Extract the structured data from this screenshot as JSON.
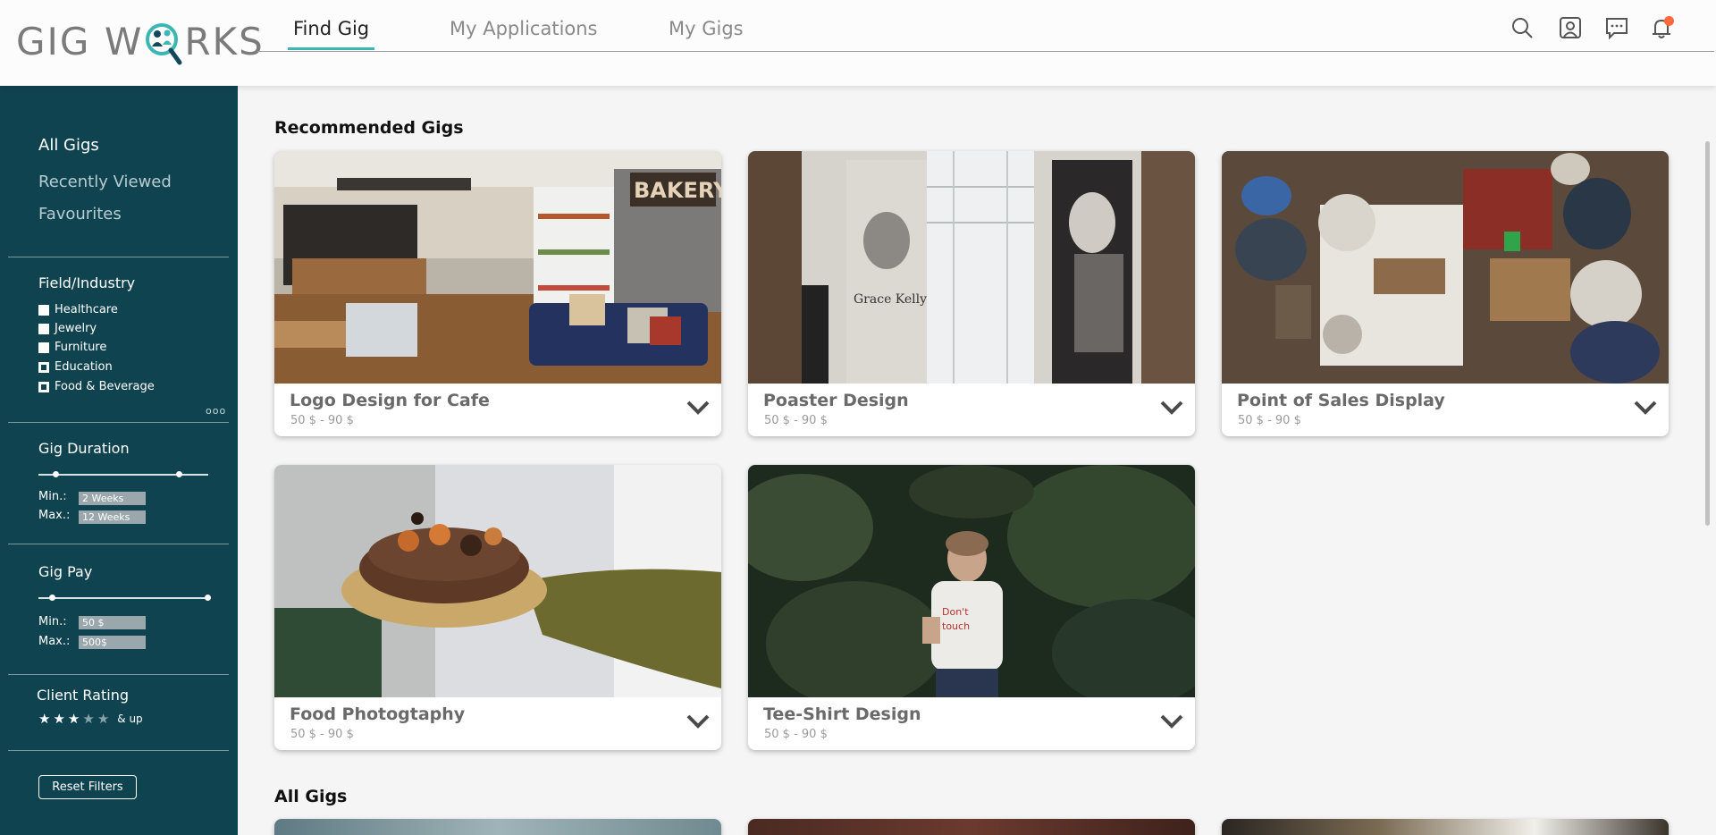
{
  "app": {
    "logo_left": "GIG W",
    "logo_right": "RKS"
  },
  "header": {
    "tabs": [
      {
        "label": "Find Gig",
        "active": true
      },
      {
        "label": "My Applications",
        "active": false
      },
      {
        "label": "My Gigs",
        "active": false
      }
    ],
    "icons": [
      "search-icon",
      "profile-icon",
      "messages-icon",
      "notifications-icon"
    ],
    "accent_color": "#3cb6b2",
    "notification_dot_color": "#ff6a3d"
  },
  "sidebar": {
    "links": [
      {
        "label": "All Gigs",
        "active": true
      },
      {
        "label": "Recently Viewed",
        "active": false
      },
      {
        "label": "Favourites",
        "active": false
      }
    ],
    "field_industry": {
      "title": "Field/Industry",
      "options": [
        {
          "label": "Healthcare",
          "checked": false
        },
        {
          "label": "Jewelry",
          "checked": false
        },
        {
          "label": "Furniture",
          "checked": false
        },
        {
          "label": "Education",
          "checked": true
        },
        {
          "label": "Food & Beverage",
          "checked": true
        }
      ],
      "more": "ooo"
    },
    "gig_duration": {
      "title": "Gig Duration",
      "min_label": "Min.:",
      "max_label": "Max.:",
      "min_value": "2 Weeks",
      "max_value": "12 Weeks",
      "range_fraction": [
        0.1,
        0.83
      ]
    },
    "gig_pay": {
      "title": "Gig Pay",
      "min_label": "Min.:",
      "max_label": "Max.:",
      "min_value": "50 $",
      "max_value": "500$",
      "range_fraction": [
        0.08,
        1.0
      ]
    },
    "client_rating": {
      "title": "Client Rating",
      "rating": 3,
      "out_of": 5,
      "suffix": "& up"
    },
    "reset_label": "Reset Filters",
    "background_color": "#0f4350"
  },
  "main": {
    "recommended_title": "Recommended Gigs",
    "all_gigs_title": "All Gigs",
    "cards": [
      {
        "title": "Logo Design for Cafe",
        "price": "50 $ - 90 $",
        "image": "cafe"
      },
      {
        "title": "Poaster Design",
        "price": "50 $ - 90 $",
        "image": "banners"
      },
      {
        "title": "Point of Sales Display",
        "price": "50 $ - 90 $",
        "image": "market"
      },
      {
        "title": "Food Photogtaphy",
        "price": "50 $ - 90 $",
        "image": "cake"
      },
      {
        "title": "Tee-Shirt Design",
        "price": "50 $ - 90 $",
        "image": "plants"
      }
    ]
  }
}
